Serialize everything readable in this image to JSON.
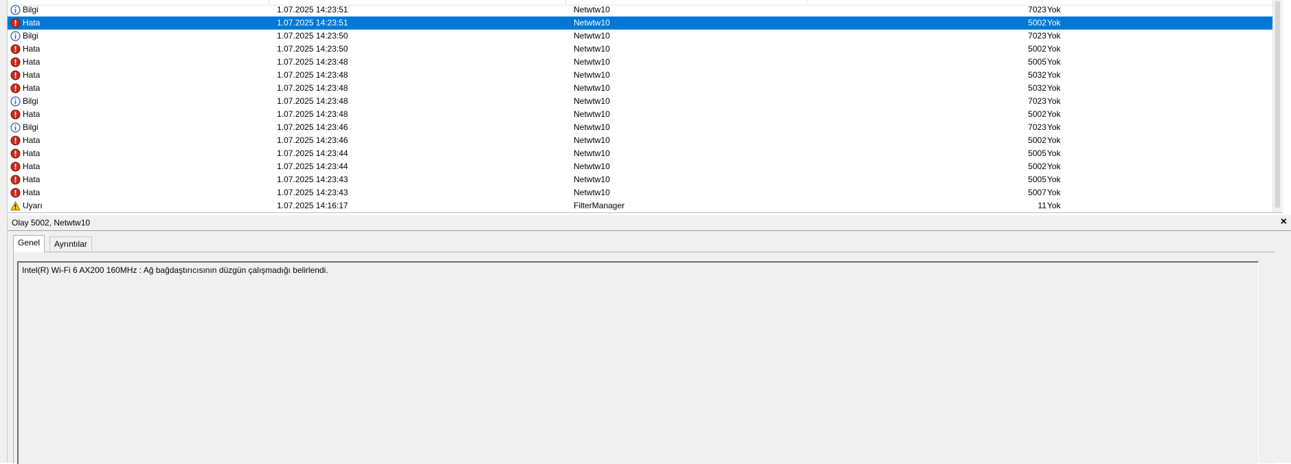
{
  "events": [
    {
      "level": "Bilgi",
      "type": "info",
      "date": "1.07.2025 14:23:51",
      "source": "Netwtw10",
      "id": "7023",
      "category": "Yok"
    },
    {
      "level": "Hata",
      "type": "error",
      "date": "1.07.2025 14:23:51",
      "source": "Netwtw10",
      "id": "5002",
      "category": "Yok",
      "selected": true
    },
    {
      "level": "Bilgi",
      "type": "info",
      "date": "1.07.2025 14:23:50",
      "source": "Netwtw10",
      "id": "7023",
      "category": "Yok"
    },
    {
      "level": "Hata",
      "type": "error",
      "date": "1.07.2025 14:23:50",
      "source": "Netwtw10",
      "id": "5002",
      "category": "Yok"
    },
    {
      "level": "Hata",
      "type": "error",
      "date": "1.07.2025 14:23:48",
      "source": "Netwtw10",
      "id": "5005",
      "category": "Yok"
    },
    {
      "level": "Hata",
      "type": "error",
      "date": "1.07.2025 14:23:48",
      "source": "Netwtw10",
      "id": "5032",
      "category": "Yok"
    },
    {
      "level": "Hata",
      "type": "error",
      "date": "1.07.2025 14:23:48",
      "source": "Netwtw10",
      "id": "5032",
      "category": "Yok"
    },
    {
      "level": "Bilgi",
      "type": "info",
      "date": "1.07.2025 14:23:48",
      "source": "Netwtw10",
      "id": "7023",
      "category": "Yok"
    },
    {
      "level": "Hata",
      "type": "error",
      "date": "1.07.2025 14:23:48",
      "source": "Netwtw10",
      "id": "5002",
      "category": "Yok"
    },
    {
      "level": "Bilgi",
      "type": "info",
      "date": "1.07.2025 14:23:46",
      "source": "Netwtw10",
      "id": "7023",
      "category": "Yok"
    },
    {
      "level": "Hata",
      "type": "error",
      "date": "1.07.2025 14:23:46",
      "source": "Netwtw10",
      "id": "5002",
      "category": "Yok"
    },
    {
      "level": "Hata",
      "type": "error",
      "date": "1.07.2025 14:23:44",
      "source": "Netwtw10",
      "id": "5005",
      "category": "Yok"
    },
    {
      "level": "Hata",
      "type": "error",
      "date": "1.07.2025 14:23:44",
      "source": "Netwtw10",
      "id": "5002",
      "category": "Yok"
    },
    {
      "level": "Hata",
      "type": "error",
      "date": "1.07.2025 14:23:43",
      "source": "Netwtw10",
      "id": "5005",
      "category": "Yok"
    },
    {
      "level": "Hata",
      "type": "error",
      "date": "1.07.2025 14:23:43",
      "source": "Netwtw10",
      "id": "5007",
      "category": "Yok"
    },
    {
      "level": "Uyarı",
      "type": "warning",
      "date": "1.07.2025 14:16:17",
      "source": "FilterManager",
      "id": "11",
      "category": "Yok"
    }
  ],
  "detail": {
    "title": "Olay 5002, Netwtw10",
    "close_label": "×",
    "tabs": [
      "Genel",
      "Ayrıntılar"
    ],
    "message": "Intel(R) Wi-Fi 6 AX200 160MHz : Ağ bağdaştırıcısının düzgün çalışmadığı belirlendi."
  },
  "icons": {
    "info": "info-icon",
    "error": "error-icon",
    "warning": "warning-icon"
  },
  "colors": {
    "selection": "#0078d7",
    "error": "#c42b1c",
    "info": "#2e5aa8",
    "warning": "#f2c811"
  }
}
